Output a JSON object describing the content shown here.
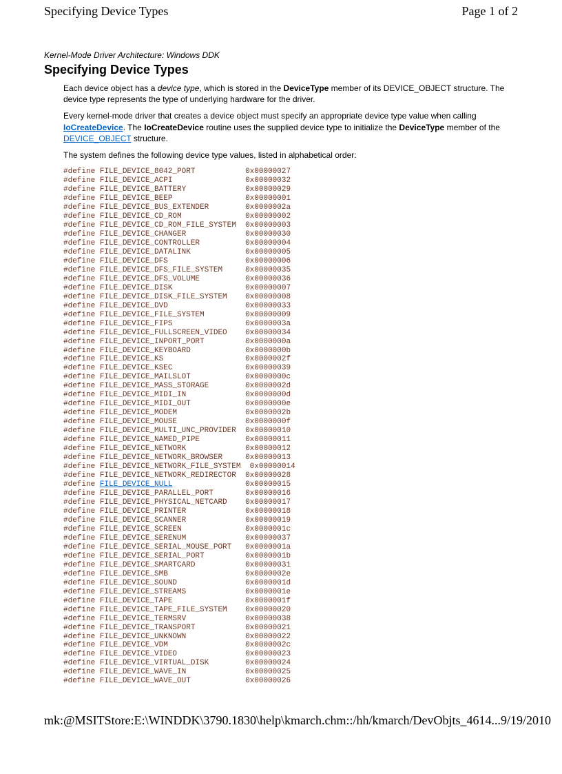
{
  "header": {
    "title": "Specifying Device Types",
    "page_indicator": "Page 1 of 2"
  },
  "section_label": "Kernel-Mode Driver Architecture: Windows DDK",
  "page_title": "Specifying Device Types",
  "paragraphs": {
    "p1_pre": "Each device object has a ",
    "p1_em": "device type",
    "p1_mid": ", which is stored in the ",
    "p1_bold": "DeviceType",
    "p1_post": " member of its DEVICE_OBJECT structure. The device type represents the type of underlying hardware for the driver.",
    "p2_pre": "Every kernel-mode driver that creates a device object must specify an appropriate device type value when calling ",
    "p2_link1": "IoCreateDevice",
    "p2_mid1": ". The ",
    "p2_bold": "IoCreateDevice",
    "p2_mid2": " routine uses the supplied device type to initialize the ",
    "p2_bold2": "DeviceType",
    "p2_post1": " member of the ",
    "p2_link2": "DEVICE_OBJECT",
    "p2_post2": " structure.",
    "p3": "The system defines the following device type values, listed in alphabetical order:"
  },
  "defines": [
    {
      "name": "FILE_DEVICE_8042_PORT",
      "value": "0x00000027",
      "link": false
    },
    {
      "name": "FILE_DEVICE_ACPI",
      "value": "0x00000032",
      "link": false
    },
    {
      "name": "FILE_DEVICE_BATTERY",
      "value": "0x00000029",
      "link": false
    },
    {
      "name": "FILE_DEVICE_BEEP",
      "value": "0x00000001",
      "link": false
    },
    {
      "name": "FILE_DEVICE_BUS_EXTENDER",
      "value": "0x0000002a",
      "link": false
    },
    {
      "name": "FILE_DEVICE_CD_ROM",
      "value": "0x00000002",
      "link": false
    },
    {
      "name": "FILE_DEVICE_CD_ROM_FILE_SYSTEM",
      "value": "0x00000003",
      "link": false
    },
    {
      "name": "FILE_DEVICE_CHANGER",
      "value": "0x00000030",
      "link": false
    },
    {
      "name": "FILE_DEVICE_CONTROLLER",
      "value": "0x00000004",
      "link": false
    },
    {
      "name": "FILE_DEVICE_DATALINK",
      "value": "0x00000005",
      "link": false
    },
    {
      "name": "FILE_DEVICE_DFS",
      "value": "0x00000006",
      "link": false
    },
    {
      "name": "FILE_DEVICE_DFS_FILE_SYSTEM",
      "value": "0x00000035",
      "link": false
    },
    {
      "name": "FILE_DEVICE_DFS_VOLUME",
      "value": "0x00000036",
      "link": false
    },
    {
      "name": "FILE_DEVICE_DISK",
      "value": "0x00000007",
      "link": false
    },
    {
      "name": "FILE_DEVICE_DISK_FILE_SYSTEM",
      "value": "0x00000008",
      "link": false
    },
    {
      "name": "FILE_DEVICE_DVD",
      "value": "0x00000033",
      "link": false
    },
    {
      "name": "FILE_DEVICE_FILE_SYSTEM",
      "value": "0x00000009",
      "link": false
    },
    {
      "name": "FILE_DEVICE_FIPS",
      "value": "0x0000003a",
      "link": false
    },
    {
      "name": "FILE_DEVICE_FULLSCREEN_VIDEO",
      "value": "0x00000034",
      "link": false
    },
    {
      "name": "FILE_DEVICE_INPORT_PORT",
      "value": "0x0000000a",
      "link": false
    },
    {
      "name": "FILE_DEVICE_KEYBOARD",
      "value": "0x0000000b",
      "link": false
    },
    {
      "name": "FILE_DEVICE_KS",
      "value": "0x0000002f",
      "link": false
    },
    {
      "name": "FILE_DEVICE_KSEC",
      "value": "0x00000039",
      "link": false
    },
    {
      "name": "FILE_DEVICE_MAILSLOT",
      "value": "0x0000000c",
      "link": false
    },
    {
      "name": "FILE_DEVICE_MASS_STORAGE",
      "value": "0x0000002d",
      "link": false
    },
    {
      "name": "FILE_DEVICE_MIDI_IN",
      "value": "0x0000000d",
      "link": false
    },
    {
      "name": "FILE_DEVICE_MIDI_OUT",
      "value": "0x0000000e",
      "link": false
    },
    {
      "name": "FILE_DEVICE_MODEM",
      "value": "0x0000002b",
      "link": false
    },
    {
      "name": "FILE_DEVICE_MOUSE",
      "value": "0x0000000f",
      "link": false
    },
    {
      "name": "FILE_DEVICE_MULTI_UNC_PROVIDER",
      "value": "0x00000010",
      "link": false
    },
    {
      "name": "FILE_DEVICE_NAMED_PIPE",
      "value": "0x00000011",
      "link": false
    },
    {
      "name": "FILE_DEVICE_NETWORK",
      "value": "0x00000012",
      "link": false
    },
    {
      "name": "FILE_DEVICE_NETWORK_BROWSER",
      "value": "0x00000013",
      "link": false
    },
    {
      "name": "FILE_DEVICE_NETWORK_FILE_SYSTEM",
      "value": "0x00000014",
      "link": false
    },
    {
      "name": "FILE_DEVICE_NETWORK_REDIRECTOR",
      "value": "0x00000028",
      "link": false
    },
    {
      "name": "FILE_DEVICE_NULL",
      "value": "0x00000015",
      "link": true
    },
    {
      "name": "FILE_DEVICE_PARALLEL_PORT",
      "value": "0x00000016",
      "link": false
    },
    {
      "name": "FILE_DEVICE_PHYSICAL_NETCARD",
      "value": "0x00000017",
      "link": false
    },
    {
      "name": "FILE_DEVICE_PRINTER",
      "value": "0x00000018",
      "link": false
    },
    {
      "name": "FILE_DEVICE_SCANNER",
      "value": "0x00000019",
      "link": false
    },
    {
      "name": "FILE_DEVICE_SCREEN",
      "value": "0x0000001c",
      "link": false
    },
    {
      "name": "FILE_DEVICE_SERENUM",
      "value": "0x00000037",
      "link": false
    },
    {
      "name": "FILE_DEVICE_SERIAL_MOUSE_PORT",
      "value": "0x0000001a",
      "link": false
    },
    {
      "name": "FILE_DEVICE_SERIAL_PORT",
      "value": "0x0000001b",
      "link": false
    },
    {
      "name": "FILE_DEVICE_SMARTCARD",
      "value": "0x00000031",
      "link": false
    },
    {
      "name": "FILE_DEVICE_SMB",
      "value": "0x0000002e",
      "link": false
    },
    {
      "name": "FILE_DEVICE_SOUND",
      "value": "0x0000001d",
      "link": false
    },
    {
      "name": "FILE_DEVICE_STREAMS",
      "value": "0x0000001e",
      "link": false
    },
    {
      "name": "FILE_DEVICE_TAPE",
      "value": "0x0000001f",
      "link": false
    },
    {
      "name": "FILE_DEVICE_TAPE_FILE_SYSTEM",
      "value": "0x00000020",
      "link": false
    },
    {
      "name": "FILE_DEVICE_TERMSRV",
      "value": "0x00000038",
      "link": false
    },
    {
      "name": "FILE_DEVICE_TRANSPORT",
      "value": "0x00000021",
      "link": false
    },
    {
      "name": "FILE_DEVICE_UNKNOWN",
      "value": "0x00000022",
      "link": false
    },
    {
      "name": "FILE_DEVICE_VDM",
      "value": "0x0000002c",
      "link": false
    },
    {
      "name": "FILE_DEVICE_VIDEO",
      "value": "0x00000023",
      "link": false
    },
    {
      "name": "FILE_DEVICE_VIRTUAL_DISK",
      "value": "0x00000024",
      "link": false
    },
    {
      "name": "FILE_DEVICE_WAVE_IN",
      "value": "0x00000025",
      "link": false
    },
    {
      "name": "FILE_DEVICE_WAVE_OUT",
      "value": "0x00000026",
      "link": false
    }
  ],
  "footer": {
    "path": "mk:@MSITStore:E:\\WINDDK\\3790.1830\\help\\kmarch.chm::/hh/kmarch/DevObjts_4614...",
    "date": "9/19/2010"
  },
  "name_col_width": 31
}
